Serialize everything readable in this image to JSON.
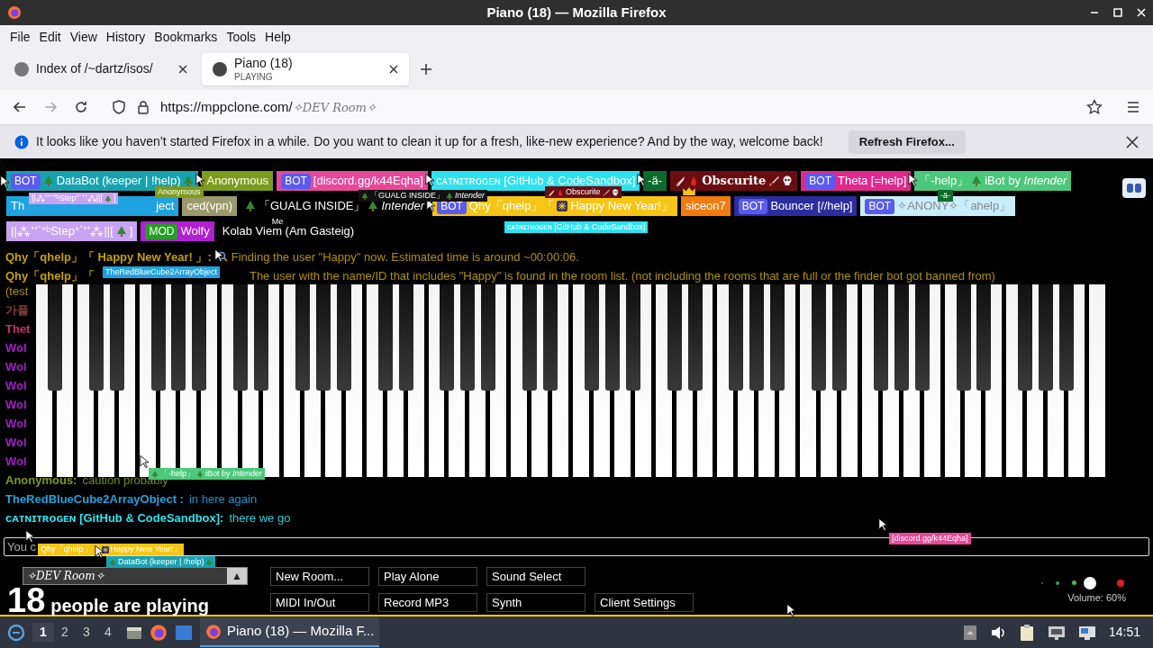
{
  "window": {
    "title": "Piano (18) — Mozilla Firefox"
  },
  "menu": [
    "File",
    "Edit",
    "View",
    "History",
    "Bookmarks",
    "Tools",
    "Help"
  ],
  "tabs": [
    {
      "title": "Index of /~dartz/isos/",
      "selected": false
    },
    {
      "title": "Piano (18)",
      "subtitle": "PLAYING",
      "selected": true
    }
  ],
  "address": {
    "url": "https://mppclone.com/",
    "path": "✧DEV Room✧"
  },
  "notification": {
    "text": "It looks like you haven’t started Firefox in a while. Do you want to clean it up for a fresh, like-new experience? And by the way, welcome back!",
    "button": "Refresh Firefox..."
  },
  "user_rows": [
    {
      "users": [
        {
          "badge": {
            "kind": "bot",
            "text": "BOT"
          },
          "parts": [
            {
              "kind": "tree"
            },
            "DataBot (keeper | !help)",
            {
              "kind": "tree"
            }
          ],
          "color": "#17a2b0"
        },
        {
          "parts": [
            "Anonymous"
          ],
          "color": "#7d9b1c"
        },
        {
          "badge": {
            "kind": "bot",
            "text": "BOT"
          },
          "parts": [
            "[discord.gg/k44Eqha]"
          ],
          "color": "#e8489a"
        },
        {
          "parts": [
            "ᴄᴀᴛɴɪᴛʀᴏɢᴇɴ [GitHub & CodeSandbox]"
          ],
          "color": "#2de2f0"
        },
        {
          "parts": [
            "-ä-"
          ],
          "color": "#0d6b2b"
        },
        {
          "parts": [
            {
              "kind": "knife"
            },
            {
              "kind": "drop"
            },
            "Obscurite",
            {
              "kind": "dagger"
            },
            {
              "kind": "skull"
            }
          ],
          "color": "#6a0d12",
          "kind": "fancy"
        },
        {
          "badge": {
            "kind": "bot",
            "text": "BOT"
          },
          "parts": [
            "Theta [=help]"
          ],
          "color": "#e0298f"
        },
        {
          "parts": [
            "「-help」",
            {
              "kind": "tree"
            },
            "iBot by *Intender*"
          ],
          "color": "#4cc87a"
        }
      ]
    },
    {
      "users": [
        {
          "parts": [
            "Th",
            "ject"
          ],
          "color": "#1fa3e0"
        },
        {
          "parts": [
            "ced(vpn)"
          ],
          "color": "#9c9a6c"
        },
        {
          "parts": [
            {
              "kind": "tree"
            },
            "「GUALG INSIDE」",
            {
              "kind": "tree"
            },
            "*Intender*"
          ]
        },
        {
          "badge": {
            "kind": "bot",
            "text": "BOT"
          },
          "parts": [
            "Qhy「qhelp」「",
            {
              "kind": "firework"
            },
            "Happy New Year!」"
          ],
          "color": "#f7c516"
        },
        {
          "parts": [
            "siceon7"
          ],
          "color": "#f27b0f",
          "crown": true
        },
        {
          "badge": {
            "kind": "bot",
            "text": "BOT"
          },
          "parts": [
            "Bouncer [//help]"
          ],
          "color": "#2b2d9e"
        },
        {
          "badge": {
            "kind": "bot",
            "text": "BOT"
          },
          "parts": [
            "✧ANONY✧「ahelp」"
          ],
          "color": "#c9eefb"
        }
      ]
    },
    {
      "users": [
        {
          "parts": [
            "||⁂⁺⁺`°ᵇStep°´⁺⁺⁂||[",
            {
              "kind": "tree"
            },
            "]"
          ],
          "color": "#c9a3f3"
        },
        {
          "badge": {
            "kind": "mod",
            "text": "MOD"
          },
          "parts": [
            "Wolfy"
          ],
          "color": "#b11fd3"
        },
        {
          "parts": [
            "Kolab Viem (Am Gasteig)"
          ],
          "me_label": "Me"
        }
      ]
    }
  ],
  "floating_labels": [
    {
      "parts": [
        "Anonymous"
      ],
      "color": "#7d9b1c"
    },
    {
      "parts": [
        "||⁂⁺⁺`°ᵇStep°´⁺⁺⁂||[",
        {
          "kind": "tree"
        },
        "]"
      ],
      "color": "#c9a3f3"
    },
    {
      "parts": [
        {
          "kind": "tree"
        },
        "「GUALG INSIDE」",
        {
          "kind": "tree"
        },
        "*Intender*"
      ],
      "color": "#111111"
    },
    {
      "parts": [
        {
          "kind": "knife"
        },
        {
          "kind": "drop"
        },
        "Obscurite",
        {
          "kind": "dagger"
        },
        {
          "kind": "skull"
        }
      ],
      "color": "#6a0d12"
    },
    {
      "parts": [
        "-ä-"
      ],
      "color": "#0d6b2b"
    },
    {
      "parts": [
        "ᴄᴀᴛɴɪᴛʀᴏɢᴇɴ [GitHub & CodeSandbox]"
      ],
      "color": "#2de2f0"
    },
    {
      "parts": [
        "TheRedBlueCube2ArrayObject"
      ],
      "color": "#1fa3e0"
    },
    {
      "parts": [
        {
          "kind": "tree"
        },
        "「-help」",
        {
          "kind": "tree"
        },
        "iBot by *Intender*"
      ],
      "color": "#4cc87a"
    },
    {
      "parts": [
        "Qhy「qhelp」「",
        {
          "kind": "firework"
        },
        "Happy New Year!」"
      ],
      "color": "#f7c516"
    },
    {
      "parts": [
        {
          "kind": "tree"
        },
        "DataBot (keeper | !help)",
        {
          "kind": "tree"
        }
      ],
      "color": "#17a2b0"
    },
    {
      "parts": [
        "[discord.gg/k44Eqha]"
      ],
      "color": "#e8489a"
    }
  ],
  "chat": [
    {
      "name": "Qhy「qhelp」「 Happy New Year! 」:",
      "color": "#c4a000",
      "parts": [
        {
          "kind": "search"
        },
        "Finding the user \"Happy\" now. Estimated time is around ~00:00:06."
      ]
    },
    {
      "name": "Qhy「qhelp」「",
      "color": "#c4a000",
      "parts": [
        "The user with the name/ID that includes \"Happy\" is found in the room list. (not including the rooms that are full or the finder bot got banned from)",
        "(test"
      ]
    },
    {
      "name": "가플",
      "color": "#8b3b3b"
    },
    {
      "name": "Thet",
      "color": "#c2306b"
    },
    {
      "name": "Wol",
      "color": "#a11fc4"
    },
    {
      "name": "Wol",
      "color": "#a11fc4"
    },
    {
      "name": "Wol",
      "color": "#a11fc4"
    },
    {
      "name": "Wol",
      "color": "#a11fc4"
    },
    {
      "name": "Wol",
      "color": "#a11fc4"
    },
    {
      "name": "Wol",
      "color": "#a11fc4"
    },
    {
      "name": "Wol",
      "color": "#a11fc4"
    },
    {
      "name": "Anonymous:",
      "color": "#7d9b1c",
      "parts": [
        "caution probably"
      ]
    },
    {
      "name": "TheRedBlueCube2ArrayObject :",
      "color": "#1fa3e0",
      "parts": [
        "in here again"
      ]
    },
    {
      "name": "ᴄᴀᴛɴɪᴛʀᴏɢᴇɴ [GitHub & CodeSandbox]:",
      "color": "#2de2f0",
      "parts": [
        "there we go"
      ]
    }
  ],
  "input": {
    "placeholder": "You c"
  },
  "room": {
    "name": "✧DEV Room✧",
    "button": "▲"
  },
  "players": {
    "count": "18",
    "label": "people are playing"
  },
  "buttons": [
    [
      "New Room...",
      "Play Alone",
      "Sound Select"
    ],
    [
      "MIDI In/Out",
      "Record MP3",
      "Synth",
      "Client Settings"
    ]
  ],
  "volume": {
    "level": 0.6,
    "label": "Volume: 60%"
  },
  "taskbar": {
    "workspaces": [
      {
        "label": "1",
        "selected": true
      },
      {
        "label": "2",
        "selected": false
      },
      {
        "label": "3",
        "selected": false
      },
      {
        "label": "4",
        "selected": false
      }
    ],
    "task": "Piano (18) — Mozilla F...",
    "clock": "14:51"
  }
}
